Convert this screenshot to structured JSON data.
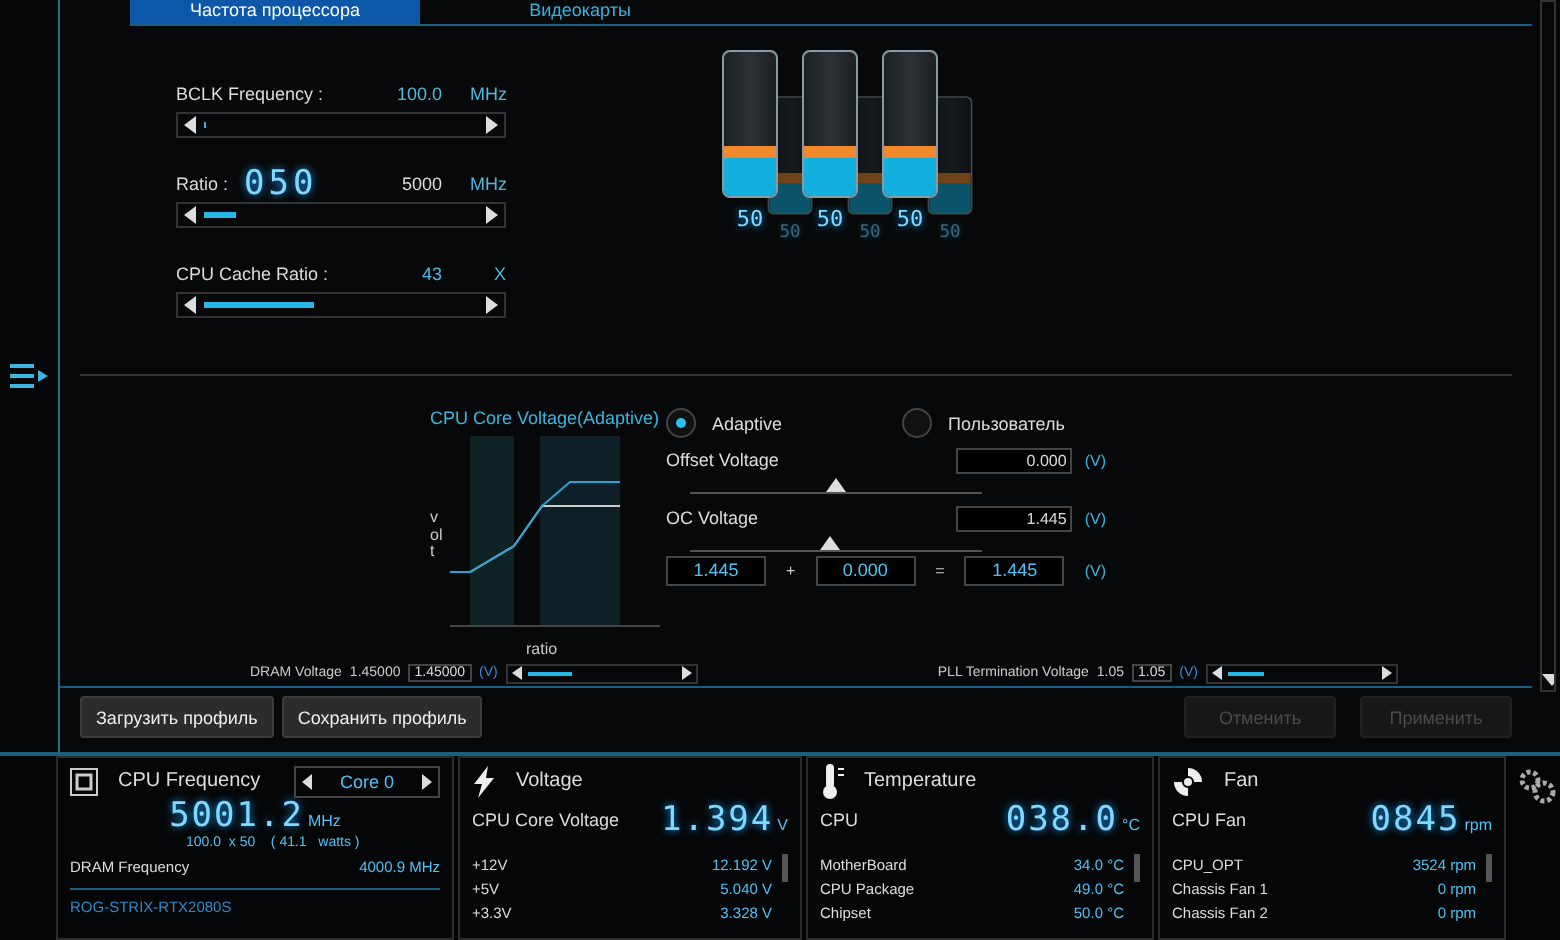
{
  "tabs": [
    {
      "label": "Частота процессора",
      "selected": true
    },
    {
      "label": "Видеокарты",
      "selected": false
    }
  ],
  "frequency_settings": [
    {
      "label": "BCLK Frequency :",
      "value": "100.0",
      "unit": "MHz",
      "level": 0.01
    },
    {
      "label": "Ratio :",
      "big_value": "050",
      "value": "5000",
      "unit": "MHz",
      "level": 0.12
    },
    {
      "label": "CPU Cache Ratio :",
      "value": "43",
      "unit": "X",
      "level": 0.4
    }
  ],
  "cylinders": [
    {
      "kind": "front",
      "label": "50",
      "level": 0.35
    },
    {
      "kind": "back",
      "label": "50",
      "level": 0.35
    },
    {
      "kind": "front",
      "label": "50",
      "level": 0.35
    },
    {
      "kind": "back",
      "label": "50",
      "level": 0.35
    },
    {
      "kind": "front",
      "label": "50",
      "level": 0.35
    },
    {
      "kind": "back",
      "label": "50",
      "level": 0.35
    }
  ],
  "voltage": {
    "title": "CPU Core Voltage(Adaptive)",
    "graph_ylabel": "volt",
    "graph_xlabel": "ratio",
    "modes": [
      {
        "label": "Adaptive",
        "selected": true
      },
      {
        "label": "Пользователь",
        "selected": false
      }
    ],
    "controls": [
      {
        "label": "Offset Voltage",
        "value": "0.000",
        "unit": "(V)",
        "level": 0.5
      },
      {
        "label": "OC Voltage",
        "value": "1.445",
        "unit": "(V)",
        "level": 0.48
      }
    ],
    "sum": {
      "a": "1.445",
      "plus": "+",
      "b": "0.000",
      "equals": "=",
      "result": "1.445",
      "unit": "(V)"
    }
  },
  "extra_voltages": [
    {
      "label": "DRAM Voltage",
      "reading": "1.45000",
      "value": "1.45000",
      "unit": "(V)",
      "level": 0.3
    },
    {
      "label": "PLL Termination Voltage",
      "reading": "1.05",
      "value": "1.05",
      "unit": "(V)",
      "level": 0.25
    }
  ],
  "buttons_left": [
    {
      "label": "Загрузить профиль",
      "disabled": false
    },
    {
      "label": "Сохранить профиль",
      "disabled": false
    }
  ],
  "buttons_right": [
    {
      "label": "Отменить",
      "disabled": true
    },
    {
      "label": "Применить",
      "disabled": true
    }
  ],
  "monitor": [
    {
      "kind": "cpu",
      "title": "CPU Frequency",
      "selector": "Core 0",
      "big": "5001.2",
      "big_unit": "MHz",
      "detail": "100.0  x 50    ( 41.1   watts )",
      "rows": [
        {
          "name": "DRAM Frequency",
          "value": "4000.9 MHz"
        }
      ],
      "footer": "ROG-STRIX-RTX2080S"
    },
    {
      "kind": "voltage",
      "title": "Voltage",
      "main_label": "CPU Core Voltage",
      "big": "1.394",
      "big_unit": "V",
      "rows": [
        {
          "name": "+12V",
          "value": "12.192 V"
        },
        {
          "name": "+5V",
          "value": "5.040 V"
        },
        {
          "name": "+3.3V",
          "value": "3.328 V"
        }
      ]
    },
    {
      "kind": "temperature",
      "title": "Temperature",
      "main_label": "CPU",
      "big": "038.0",
      "big_unit": "°C",
      "rows": [
        {
          "name": "MotherBoard",
          "value": "34.0 °C"
        },
        {
          "name": "CPU Package",
          "value": "49.0 °C"
        },
        {
          "name": "Chipset",
          "value": "50.0 °C"
        }
      ]
    },
    {
      "kind": "fan",
      "title": "Fan",
      "main_label": "CPU Fan",
      "big": "0845",
      "big_unit": "rpm",
      "rows": [
        {
          "name": "CPU_OPT",
          "value": "3524 rpm"
        },
        {
          "name": "Chassis Fan 1",
          "value": "0 rpm"
        },
        {
          "name": "Chassis Fan 2",
          "value": "0 rpm"
        }
      ]
    }
  ]
}
